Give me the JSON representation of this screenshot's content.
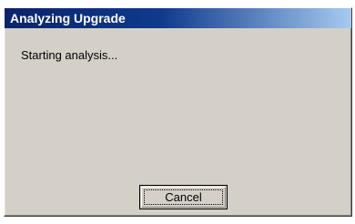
{
  "window": {
    "title": "Analyzing Upgrade"
  },
  "main": {
    "status_text": "Starting analysis..."
  },
  "buttons": {
    "cancel_label": "Cancel"
  },
  "colors": {
    "titlebar_start": "#0a246a",
    "titlebar_end": "#a6caf0",
    "dialog_background": "#d4d0c8",
    "title_text": "#ffffff"
  }
}
